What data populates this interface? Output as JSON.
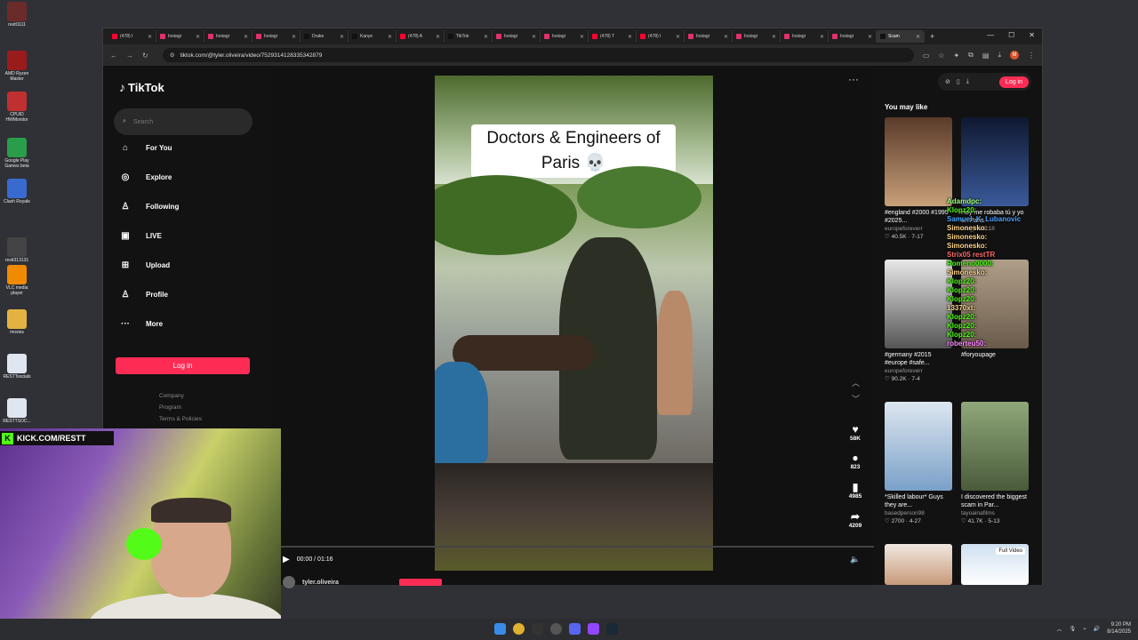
{
  "desktop": {
    "icons": [
      {
        "label": "restt1111",
        "color": "#6b2b2b"
      },
      {
        "label": "AMD Ryzen Master",
        "color": "#9b1b1b"
      },
      {
        "label": "CPUID HWMonitor",
        "color": "#c03030"
      },
      {
        "label": "Google Play Games beta",
        "color": "#2a9d4a"
      },
      {
        "label": "Clash Royale",
        "color": "#3a6ad0"
      },
      {
        "label": "restt313131",
        "color": "#444444"
      },
      {
        "label": "VLC media player",
        "color": "#f08a00"
      },
      {
        "label": "movies",
        "color": "#e3b341"
      },
      {
        "label": "RESTTsocials",
        "color": "#dfe6ef"
      },
      {
        "label": "RESTTSOC...",
        "color": "#dfe6ef"
      }
    ]
  },
  "browser": {
    "tabs": [
      {
        "label": "(478) I",
        "color": "#ff0033"
      },
      {
        "label": "Instagr",
        "color": "#e1306c"
      },
      {
        "label": "Instagr",
        "color": "#e1306c"
      },
      {
        "label": "Instagr",
        "color": "#e1306c"
      },
      {
        "label": "Drake",
        "color": "#111111"
      },
      {
        "label": "Kanye",
        "color": "#111111"
      },
      {
        "label": "(478) A",
        "color": "#ff0033"
      },
      {
        "label": "TikTok",
        "color": "#111111"
      },
      {
        "label": "Instagr",
        "color": "#e1306c"
      },
      {
        "label": "Instagr",
        "color": "#e1306c"
      },
      {
        "label": "(478) T",
        "color": "#ff0033"
      },
      {
        "label": "(478) I",
        "color": "#ff0033"
      },
      {
        "label": "Instagr",
        "color": "#e1306c"
      },
      {
        "label": "Instagr",
        "color": "#e1306c"
      },
      {
        "label": "Instagr",
        "color": "#e1306c"
      },
      {
        "label": "Instagr",
        "color": "#e1306c"
      },
      {
        "label": "Scam",
        "color": "#111111",
        "active": true
      }
    ],
    "url": "tiktok.com/@tyler.oliveira/video/7529314128335342879",
    "profile_initial": "M"
  },
  "tiktok": {
    "logo": "TikTok",
    "search_placeholder": "Search",
    "nav": [
      {
        "label": "For You",
        "icon": "home-icon",
        "glyph": "⌂"
      },
      {
        "label": "Explore",
        "icon": "compass-icon",
        "glyph": "◎"
      },
      {
        "label": "Following",
        "icon": "user-icon",
        "glyph": "♙"
      },
      {
        "label": "LIVE",
        "icon": "live-icon",
        "glyph": "▣"
      },
      {
        "label": "Upload",
        "icon": "upload-icon",
        "glyph": "⊞"
      },
      {
        "label": "Profile",
        "icon": "profile-icon",
        "glyph": "♙"
      },
      {
        "label": "More",
        "icon": "more-icon",
        "glyph": "···"
      }
    ],
    "login_label": "Log in",
    "footer_links": [
      "Company",
      "Program",
      "Terms & Policies"
    ],
    "video": {
      "caption": "Doctors & Engineers of Paris 💀",
      "time": "00:00 / 01:16",
      "progress": 0.0,
      "author": "tyler.oliveira"
    },
    "actions": [
      {
        "icon": "heart-icon",
        "glyph": "♥",
        "count": "58K"
      },
      {
        "icon": "comment-icon",
        "glyph": "●",
        "count": "823"
      },
      {
        "icon": "bookmark-icon",
        "glyph": "▮",
        "count": "4985"
      },
      {
        "icon": "share-icon",
        "glyph": "➦",
        "count": "4209"
      }
    ],
    "top_login": "Log in",
    "you_may_like": "You may like",
    "cards": [
      {
        "title": "#england #2000 #1995 #2025...",
        "user": "europeforeverr",
        "views": "40.5K",
        "date": "7-17",
        "c1": "#5a3a2a",
        "c2": "#c8a07a"
      },
      {
        "title": "Hoy me robaba tú y yo en Paris",
        "user": "cris_music18",
        "views": "",
        "date": "",
        "c1": "#0f1830",
        "c2": "#3a5a9a"
      },
      {
        "title": "#germany #2015 #europe #safe...",
        "user": "europeforeverr",
        "views": "90.2K",
        "date": "7-4",
        "c1": "#e8e8e8",
        "c2": "#555555"
      },
      {
        "title": "#foryoupage",
        "user": "",
        "views": "",
        "date": "",
        "c1": "#b0a08a",
        "c2": "#6a5a4a"
      },
      {
        "title": "*Skilled labour* Guys they are...",
        "user": "basedperson98",
        "views": "2700",
        "date": "4-27",
        "c1": "#dde6f0",
        "c2": "#7aa0c8"
      },
      {
        "title": "I discovered the biggest scam in Par...",
        "user": "tayoainafilms",
        "views": "41.7K",
        "date": "5-13",
        "c1": "#8fa87a",
        "c2": "#4a5a3a"
      }
    ],
    "full_video_badge": "Full Video"
  },
  "chat": [
    {
      "user": "Adamdpc:",
      "color": "#a6ff80"
    },
    {
      "user": "Klopz20:",
      "color": "#53fc18"
    },
    {
      "user": "Samuel_K_Lubanovic",
      "color": "#4aa3ff"
    },
    {
      "user": "Simonesko:",
      "color": "#ffd58a"
    },
    {
      "user": "Simonesko:",
      "color": "#ffd58a"
    },
    {
      "user": "Simonesko:",
      "color": "#ffd58a"
    },
    {
      "user": "Strix05 restTR",
      "color": "#ff6a6a"
    },
    {
      "user": "Romeno0000:",
      "color": "#53fc18"
    },
    {
      "user": "Simonesko:",
      "color": "#ffd58a"
    },
    {
      "user": "Klopz20:",
      "color": "#53fc18"
    },
    {
      "user": "Klopz20:",
      "color": "#53fc18"
    },
    {
      "user": "Klopz20:",
      "color": "#53fc18"
    },
    {
      "user": "13370xt:",
      "color": "#ffd58a"
    },
    {
      "user": "Klopz20:",
      "color": "#53fc18"
    },
    {
      "user": "Klopz20:",
      "color": "#53fc18"
    },
    {
      "user": "Klopz20:",
      "color": "#53fc18"
    },
    {
      "user": "roberteu50:",
      "color": "#ff88ff"
    }
  ],
  "overlay": {
    "kick_label": "KICK.COM/RESTT"
  },
  "taskbar": {
    "time": "9:20 PM",
    "date": "8/14/2025"
  }
}
